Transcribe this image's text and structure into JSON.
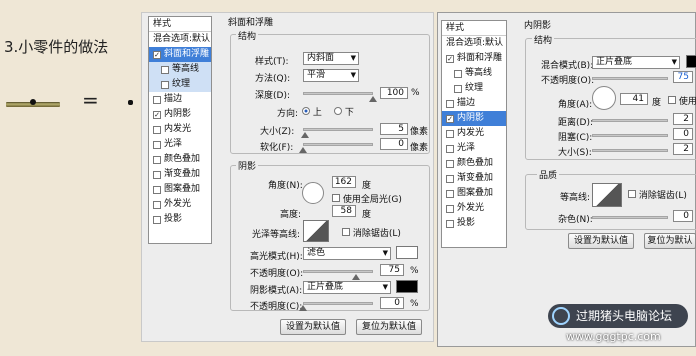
{
  "tutorial": {
    "title": "3.小零件的做法",
    "equals": "="
  },
  "dialog1": {
    "sidebar": {
      "header": "样式",
      "items": [
        {
          "label": "混合选项:默认",
          "cb": "",
          "sub": false,
          "state": ""
        },
        {
          "label": "斜面和浮雕",
          "cb": "✓",
          "sub": false,
          "state": "sel"
        },
        {
          "label": "等高线",
          "cb": "",
          "sub": true,
          "state": "selb"
        },
        {
          "label": "纹理",
          "cb": "",
          "sub": true,
          "state": "selb"
        },
        {
          "label": "描边",
          "cb": "",
          "sub": false,
          "state": ""
        },
        {
          "label": "内阴影",
          "cb": "✓",
          "sub": false,
          "state": ""
        },
        {
          "label": "内发光",
          "cb": "",
          "sub": false,
          "state": ""
        },
        {
          "label": "光泽",
          "cb": "",
          "sub": false,
          "state": ""
        },
        {
          "label": "颜色叠加",
          "cb": "",
          "sub": false,
          "state": ""
        },
        {
          "label": "渐变叠加",
          "cb": "",
          "sub": false,
          "state": ""
        },
        {
          "label": "图案叠加",
          "cb": "",
          "sub": false,
          "state": ""
        },
        {
          "label": "外发光",
          "cb": "",
          "sub": false,
          "state": ""
        },
        {
          "label": "投影",
          "cb": "",
          "sub": false,
          "state": ""
        }
      ]
    },
    "section_title": "斜面和浮雕",
    "structure": {
      "title": "结构",
      "style_label": "样式(T):",
      "style_value": "内斜面",
      "method_label": "方法(Q):",
      "method_value": "平滑",
      "depth_label": "深度(D):",
      "depth_value": "100",
      "depth_unit": "%",
      "depth_level": 1.0,
      "direction_label": "方向:",
      "dir_up": "上",
      "dir_down": "下",
      "size_label": "大小(Z):",
      "size_value": "5",
      "size_unit": "像素",
      "size_level": 0.03,
      "soften_label": "软化(F):",
      "soften_value": "0",
      "soften_unit": "像素",
      "soften_level": 0.0
    },
    "shading": {
      "title": "阴影",
      "angle_label": "角度(N):",
      "angle_value": "162",
      "angle_unit": "度",
      "global_light": "使用全局光(G)",
      "altitude_label": "高度:",
      "altitude_value": "58",
      "altitude_unit": "度",
      "gloss_label": "光泽等高线:",
      "antialias": "消除锯齿(L)",
      "highlight_label": "高光模式(H):",
      "highlight_value": "滤色",
      "highlight_color": "#ffffff",
      "hl_opacity_label": "不透明度(O):",
      "hl_opacity_value": "75",
      "hl_opacity_unit": "%",
      "hl_opacity_level": 0.75,
      "shadow_label": "阴影模式(A):",
      "shadow_value": "正片叠底",
      "shadow_color": "#000000",
      "sh_opacity_label": "不透明度(C):",
      "sh_opacity_value": "0",
      "sh_opacity_unit": "%",
      "sh_opacity_level": 0.0
    },
    "btn_default": "设置为默认值",
    "btn_reset": "复位为默认值"
  },
  "dialog2": {
    "sidebar": {
      "header": "样式",
      "items": [
        {
          "label": "混合选项:默认",
          "cb": "",
          "sub": false,
          "state": ""
        },
        {
          "label": "斜面和浮雕",
          "cb": "✓",
          "sub": false,
          "state": ""
        },
        {
          "label": "等高线",
          "cb": "",
          "sub": true,
          "state": ""
        },
        {
          "label": "纹理",
          "cb": "",
          "sub": true,
          "state": ""
        },
        {
          "label": "描边",
          "cb": "",
          "sub": false,
          "state": ""
        },
        {
          "label": "内阴影",
          "cb": "✓",
          "sub": false,
          "state": "sel"
        },
        {
          "label": "内发光",
          "cb": "",
          "sub": false,
          "state": ""
        },
        {
          "label": "光泽",
          "cb": "",
          "sub": false,
          "state": ""
        },
        {
          "label": "颜色叠加",
          "cb": "",
          "sub": false,
          "state": ""
        },
        {
          "label": "渐变叠加",
          "cb": "",
          "sub": false,
          "state": ""
        },
        {
          "label": "图案叠加",
          "cb": "",
          "sub": false,
          "state": ""
        },
        {
          "label": "外发光",
          "cb": "",
          "sub": false,
          "state": ""
        },
        {
          "label": "投影",
          "cb": "",
          "sub": false,
          "state": ""
        }
      ]
    },
    "section_title": "内阴影",
    "structure": {
      "title": "结构",
      "blend_label": "混合模式(B):",
      "blend_value": "正片叠底",
      "blend_color": "#000000",
      "opacity_label": "不透明度(O):",
      "opacity_value": "75",
      "angle_label": "角度(A):",
      "angle_value": "41",
      "angle_unit": "度",
      "global_light": "使用",
      "distance_label": "距离(D):",
      "distance_value": "2",
      "choke_label": "阻塞(C):",
      "choke_value": "0",
      "size_label": "大小(S):",
      "size_value": "2"
    },
    "quality": {
      "title": "品质",
      "contour_label": "等高线:",
      "antialias": "消除锯齿(L)",
      "noise_label": "杂色(N):",
      "noise_value": "0"
    },
    "btn_default": "设置为默认值",
    "btn_reset": "复位为默认"
  },
  "watermark": {
    "text": "过期猪头电脑论坛",
    "url": "www.gqgtpc.com"
  }
}
